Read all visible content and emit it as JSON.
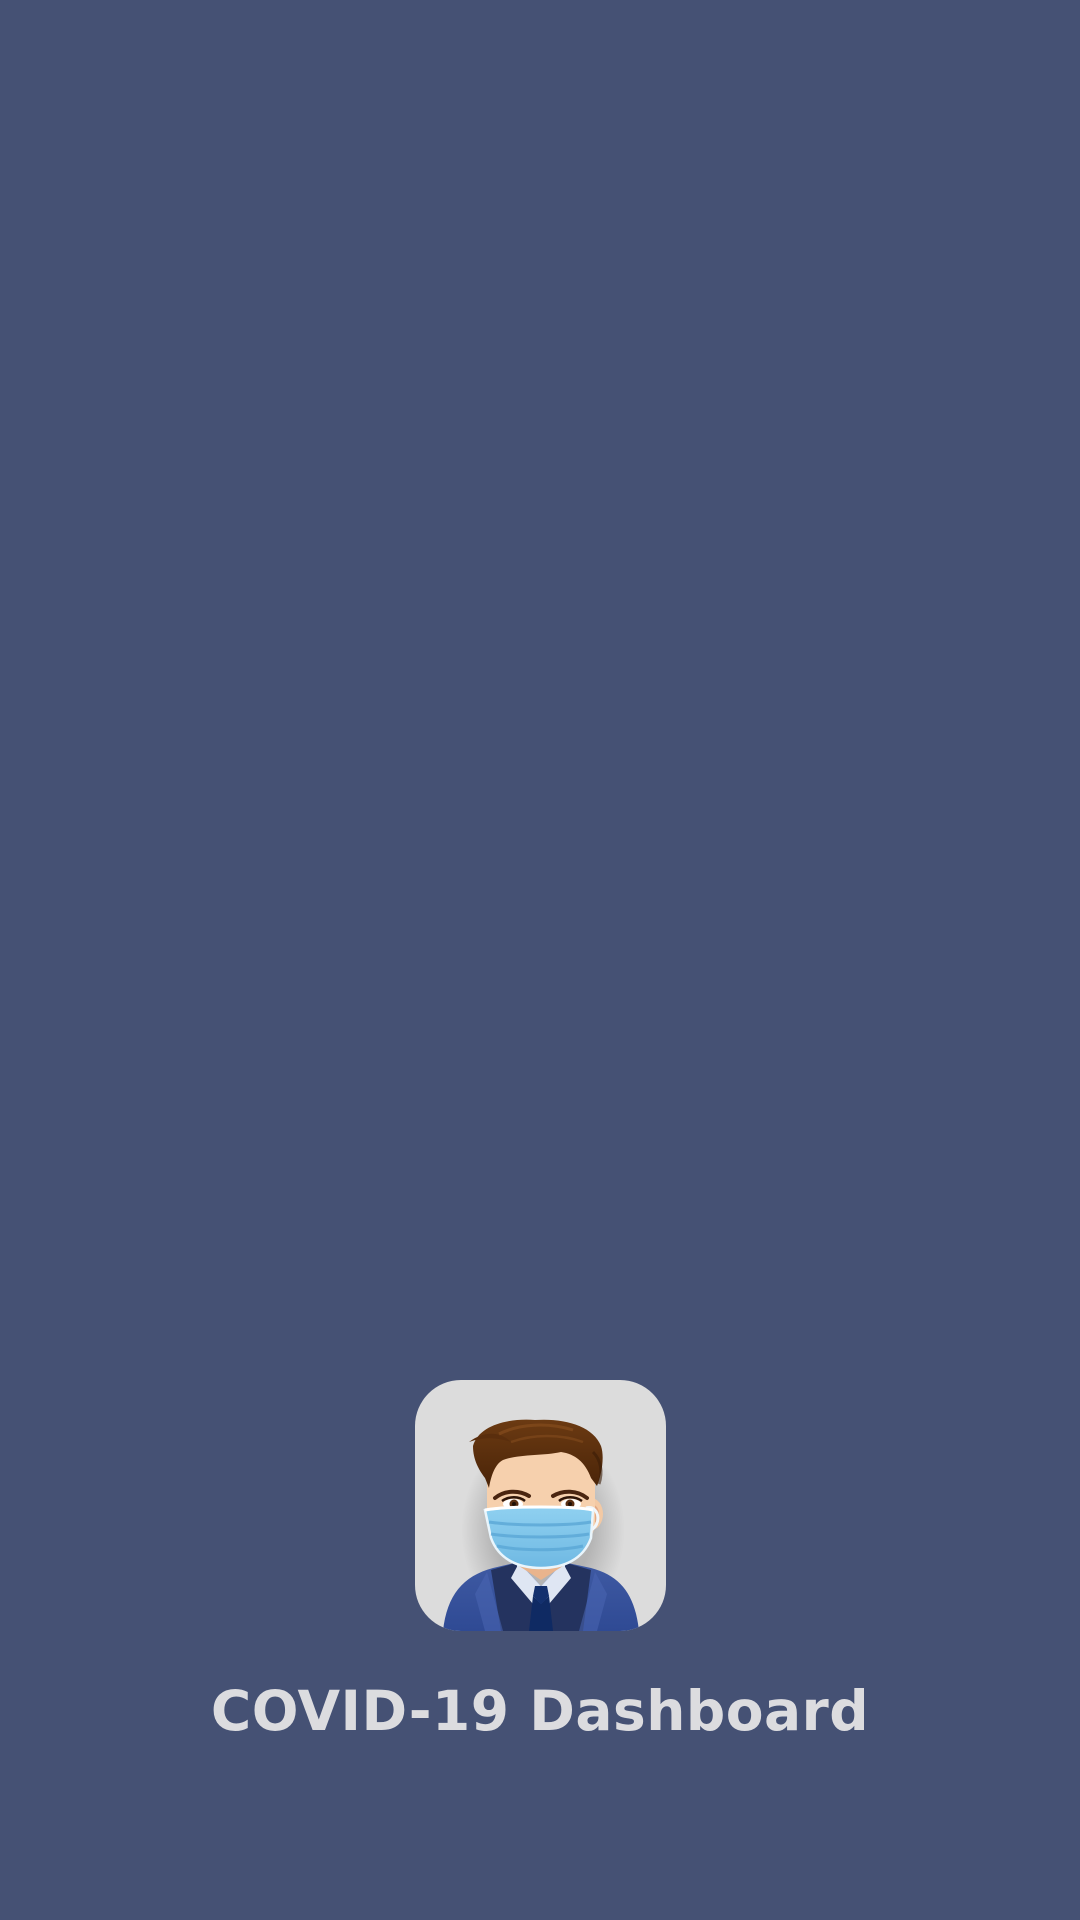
{
  "splash": {
    "app_title": "COVID-19 Dashboard",
    "logo_icon": "masked-man-avatar-icon"
  },
  "colors": {
    "background": "#455174",
    "logo_tile": "#dcdcdc",
    "title_text": "#dcdcdf"
  }
}
